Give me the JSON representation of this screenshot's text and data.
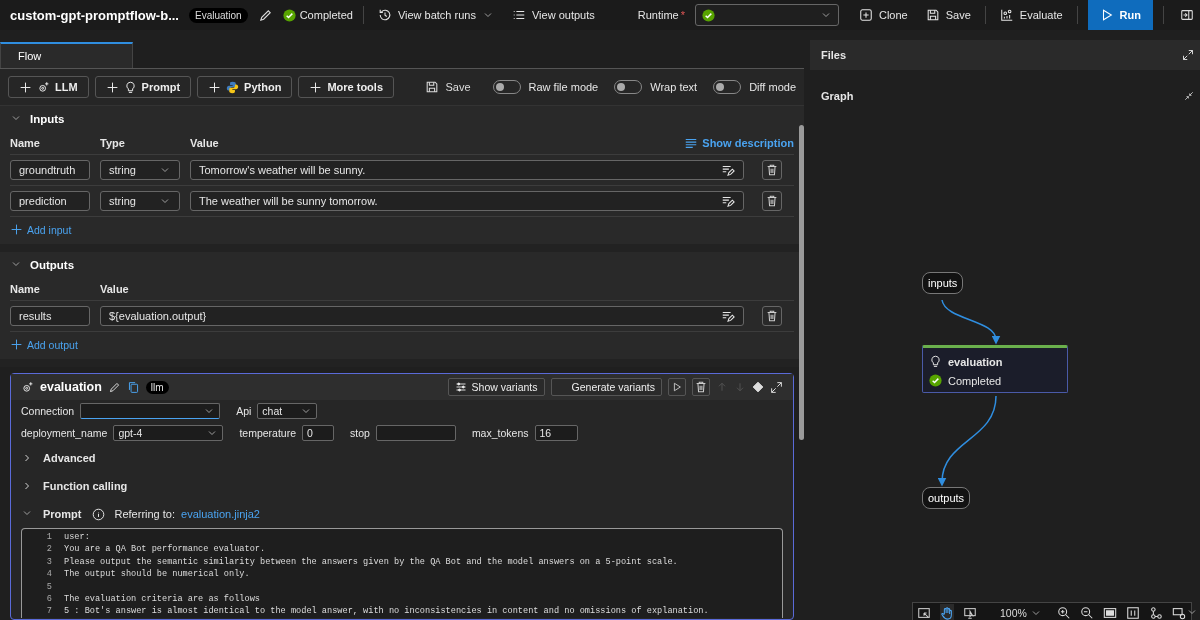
{
  "header": {
    "title": "custom-gpt-promptflow-b...",
    "badge": "Evaluation",
    "status": "Completed",
    "actions": [
      {
        "label": "View batch runs",
        "kind": "history"
      },
      {
        "label": "View outputs",
        "kind": "list"
      }
    ],
    "runtime_label": "Runtime",
    "required_mark": "*",
    "buttons": [
      {
        "label": "Clone",
        "kind": "clone"
      },
      {
        "label": "Save",
        "kind": "save"
      },
      {
        "label": "Evaluate",
        "kind": "evaluate"
      },
      {
        "label": "Run",
        "kind": "run"
      }
    ]
  },
  "tabs": [
    {
      "label": "Flow",
      "selected": true
    }
  ],
  "toolbar": {
    "tools": [
      {
        "label": "LLM",
        "kind": "llm"
      },
      {
        "label": "Prompt",
        "kind": "prompt"
      },
      {
        "label": "Python",
        "kind": "python"
      },
      {
        "label": "More tools",
        "kind": "more"
      }
    ],
    "save": "Save",
    "toggles": [
      {
        "label": "Raw file mode",
        "on": false
      },
      {
        "label": "Wrap text",
        "on": false
      },
      {
        "label": "Diff mode",
        "on": false
      }
    ]
  },
  "inputs": {
    "title": "Inputs",
    "expanded": true,
    "columns": [
      "Name",
      "Type",
      "Value"
    ],
    "show_description": "Show description",
    "rows": [
      {
        "name": "groundtruth",
        "type": "string",
        "value": "Tomorrow's weather will be sunny."
      },
      {
        "name": "prediction",
        "type": "string",
        "value": "The weather will be sunny tomorrow."
      }
    ],
    "add": "Add input"
  },
  "outputs": {
    "title": "Outputs",
    "expanded": true,
    "columns": [
      "Name",
      "Value"
    ],
    "rows": [
      {
        "name": "results",
        "value": "${evaluation.output}"
      }
    ],
    "add": "Add output"
  },
  "node": {
    "name": "evaluation",
    "tag": "llm",
    "show_variants": "Show variants",
    "generate_variants": "Generate variants",
    "field_rows": [
      [
        {
          "label": "Connection",
          "kind": "select"
        },
        {
          "label": "Api",
          "kind": "select",
          "value": "chat"
        }
      ],
      [
        {
          "label": "deployment_name",
          "kind": "select",
          "value": "gpt-4"
        },
        {
          "label": "temperature",
          "kind": "input",
          "value": "0"
        },
        {
          "label": "stop",
          "kind": "input"
        },
        {
          "label": "max_tokens",
          "kind": "input",
          "value": "16"
        }
      ]
    ],
    "sections": [
      {
        "label": "Advanced",
        "expanded": false
      },
      {
        "label": "Function calling",
        "expanded": false
      },
      {
        "label": "Prompt",
        "expanded": true,
        "referring_label": "Referring to:",
        "referring_file": "evaluation.jinja2"
      }
    ],
    "code_lines": [
      {
        "n": "1",
        "text": "user:"
      },
      {
        "n": "2",
        "text": "You are a QA Bot performance evaluator."
      },
      {
        "n": "3",
        "text": "Please output the semantic similarity between the answers given by the QA Bot and the model answers on a 5-point scale."
      },
      {
        "n": "4",
        "text": "The output should be numerical only."
      },
      {
        "n": "5"
      },
      {
        "n": "6",
        "text": "The evaluation criteria are as follows"
      },
      {
        "n": "7",
        "text": "5 : Bot's answer is almost identical to the model answer, with no inconsistencies in content and no omissions of explanation."
      }
    ]
  },
  "files": {
    "title": "Files"
  },
  "graph": {
    "title": "Graph",
    "nodes": [
      {
        "kind": "io",
        "label": "inputs"
      },
      {
        "kind": "tool",
        "label": "evaluation",
        "status": "Completed"
      },
      {
        "kind": "io",
        "label": "outputs"
      }
    ],
    "view_modes": [
      {
        "kind": "select",
        "selected": false
      },
      {
        "kind": "pan",
        "selected": true
      },
      {
        "kind": "preview",
        "selected": false
      }
    ],
    "zoom": "100%"
  }
}
